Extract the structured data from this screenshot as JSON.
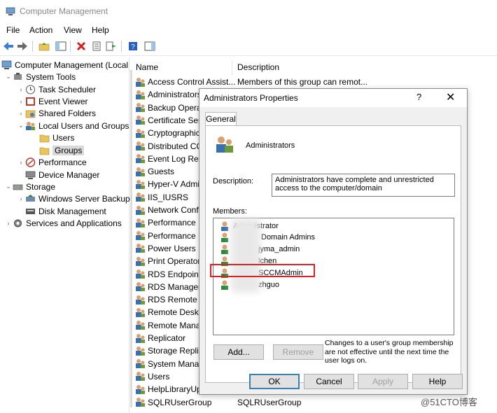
{
  "window": {
    "title": "Computer Management"
  },
  "menu": [
    "File",
    "Action",
    "View",
    "Help"
  ],
  "tree": {
    "root": "Computer Management (Local",
    "system_tools": "System Tools",
    "task_scheduler": "Task Scheduler",
    "event_viewer": "Event Viewer",
    "shared_folders": "Shared Folders",
    "local_users": "Local Users and Groups",
    "users": "Users",
    "groups": "Groups",
    "performance": "Performance",
    "device_manager": "Device Manager",
    "storage": "Storage",
    "wsb": "Windows Server Backup",
    "disk_mgmt": "Disk Management",
    "services": "Services and Applications"
  },
  "list": {
    "col_name": "Name",
    "col_desc": "Description",
    "rows": [
      {
        "name": "Access Control Assist...",
        "desc": "Members of this group can remot..."
      },
      {
        "name": "Administrators",
        "desc": ""
      },
      {
        "name": "Backup Opera",
        "desc": ""
      },
      {
        "name": "Certificate Serv",
        "desc": ""
      },
      {
        "name": "Cryptographic",
        "desc": ""
      },
      {
        "name": "Distributed CO",
        "desc": ""
      },
      {
        "name": "Event Log Rea",
        "desc": ""
      },
      {
        "name": "Guests",
        "desc": ""
      },
      {
        "name": "Hyper-V Admi",
        "desc": ""
      },
      {
        "name": "IIS_IUSRS",
        "desc": ""
      },
      {
        "name": "Network Conf",
        "desc": ""
      },
      {
        "name": "Performance L",
        "desc": ""
      },
      {
        "name": "Performance M",
        "desc": ""
      },
      {
        "name": "Power Users",
        "desc": ""
      },
      {
        "name": "Print Operator",
        "desc": ""
      },
      {
        "name": "RDS Endpoint",
        "desc": ""
      },
      {
        "name": "RDS Managem",
        "desc": ""
      },
      {
        "name": "RDS Remote A",
        "desc": ""
      },
      {
        "name": "Remote Deskto",
        "desc": ""
      },
      {
        "name": "Remote Mana",
        "desc": ""
      },
      {
        "name": "Replicator",
        "desc": ""
      },
      {
        "name": "Storage Replic",
        "desc": ""
      },
      {
        "name": "System Manag",
        "desc": ""
      },
      {
        "name": "Users",
        "desc": ""
      },
      {
        "name": "HelpLibraryUp",
        "desc": ""
      },
      {
        "name": "SQLRUserGroup",
        "desc": "SQLRUserGroup"
      }
    ]
  },
  "dialog": {
    "title": "Administrators Properties",
    "help": "?",
    "close": "✕",
    "tab": "General",
    "group_name": "Administrators",
    "description_label": "Description:",
    "description_value": "Administrators have complete and unrestricted access to the computer/domain",
    "members_label": "Members:",
    "members": [
      "Administrator",
      "Domain Admins",
      "jyma_admin",
      "lchen",
      "SCCMAdmin",
      "zhguo"
    ],
    "add": "Add...",
    "remove": "Remove",
    "note": "Changes to a user's group membership are not effective until the next time the user logs on.",
    "ok": "OK",
    "cancel": "Cancel",
    "apply": "Apply",
    "help_btn": "Help"
  },
  "watermark": "@51CTO博客",
  "colors": {
    "highlight": "#e02020",
    "selection": "#d9d9d9",
    "accent": "#3c7fb1"
  }
}
